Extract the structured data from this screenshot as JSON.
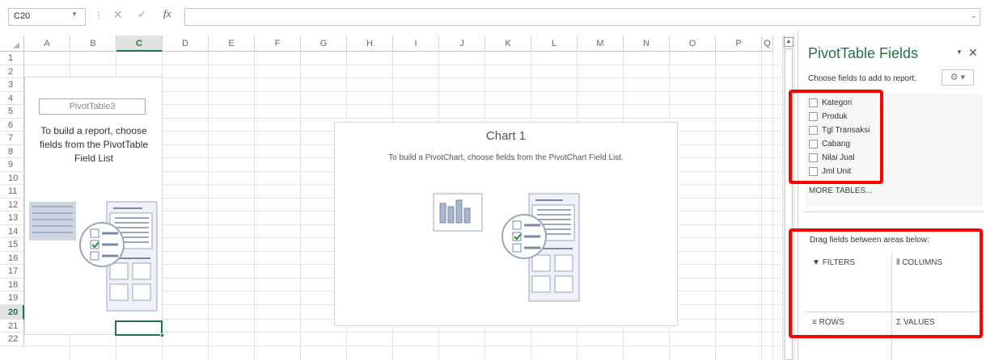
{
  "formula_bar": {
    "name_box": "C20",
    "formula": ""
  },
  "columns": [
    "A",
    "B",
    "C",
    "D",
    "E",
    "F",
    "G",
    "H",
    "I",
    "J",
    "K",
    "L",
    "M",
    "N",
    "O",
    "P",
    "Q"
  ],
  "selected_column": "C",
  "rows": [
    "1",
    "2",
    "3",
    "4",
    "5",
    "6",
    "7",
    "8",
    "9",
    "10",
    "11",
    "12",
    "13",
    "14",
    "15",
    "16",
    "17",
    "18",
    "19",
    "20",
    "21",
    "22"
  ],
  "selected_row": "20",
  "pivot_placeholder": {
    "name": "PivotTable3",
    "message": "To build a report, choose fields from the PivotTable Field List"
  },
  "chart_placeholder": {
    "title": "Chart 1",
    "message": "To build a PivotChart, choose fields from the PivotChart Field List."
  },
  "pane": {
    "title": "PivotTable Fields",
    "subtitle": "Choose fields to add to report:",
    "fields": [
      "Kategori",
      "Produk",
      "Tgl Transaksi",
      "Cabang",
      "Nilai Jual",
      "Jml Unit"
    ],
    "more_tables": "MORE TABLES...",
    "drag_label": "Drag fields between areas below:",
    "areas": {
      "filters": "FILTERS",
      "columns": "COLUMNS",
      "rows": "ROWS",
      "values": "VALUES"
    }
  },
  "highlight_color": "#ff0000",
  "accent_color": "#217346"
}
